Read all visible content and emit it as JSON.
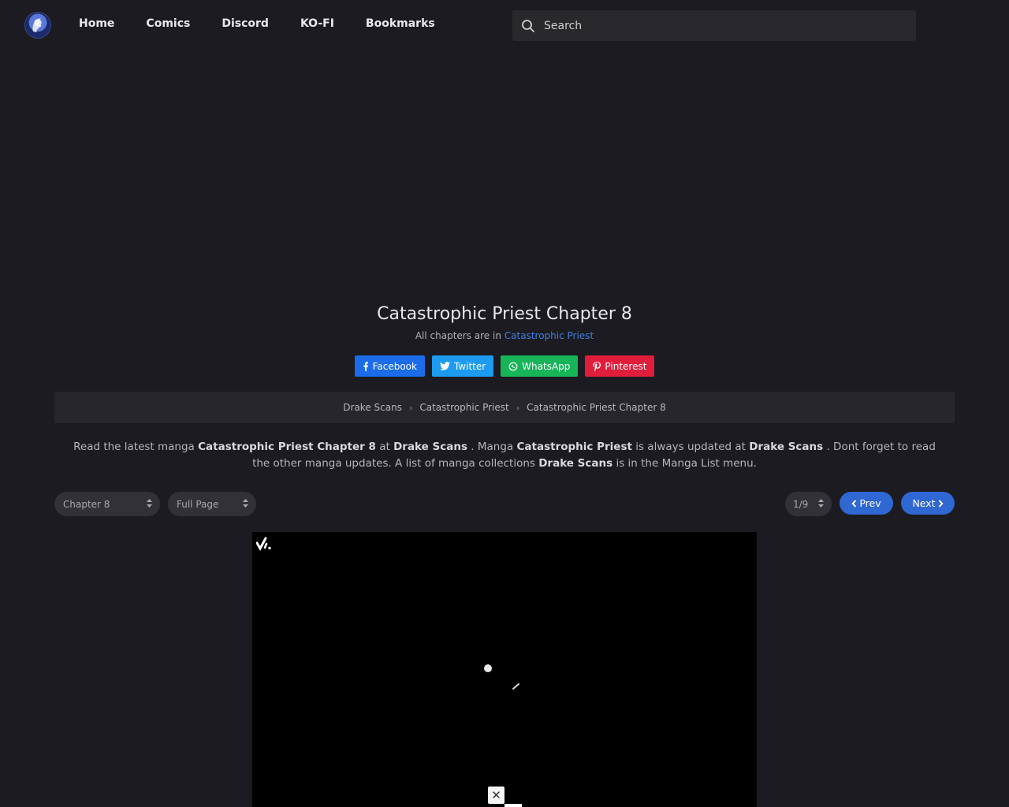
{
  "header": {
    "nav": [
      "Home",
      "Comics",
      "Discord",
      "KO-FI",
      "Bookmarks"
    ],
    "search_placeholder": "Search"
  },
  "chapter": {
    "title": "Catastrophic Priest Chapter 8",
    "all_chapters_prefix": "All chapters are in",
    "series_link": "Catastrophic Priest"
  },
  "share": {
    "facebook": "Facebook",
    "twitter": "Twitter",
    "whatsapp": "WhatsApp",
    "pinterest": "Pinterest"
  },
  "breadcrumb": [
    "Drake Scans",
    "Catastrophic Priest",
    "Catastrophic Priest Chapter 8"
  ],
  "description": {
    "t1": "Read the latest manga ",
    "b1": "Catastrophic Priest Chapter 8",
    "t2": " at ",
    "b2": "Drake Scans",
    "t3": " . Manga ",
    "b3": "Catastrophic Priest",
    "t4": " is always updated at ",
    "b4": "Drake Scans",
    "t5": " . Dont forget to read the other manga updates. A list of manga collections ",
    "b5": "Drake Scans",
    "t6": " is in the Manga List menu."
  },
  "controls": {
    "chapter_select": "Chapter 8",
    "mode_select": "Full Page",
    "page_select": "1/9",
    "prev": "Prev",
    "next": "Next"
  },
  "viewer": {
    "close_glyph": "✕"
  },
  "colors": {
    "background": "#1c1b21",
    "accent": "#2f67d3",
    "facebook": "#1a6ce8",
    "twitter": "#1d9bf0",
    "whatsapp": "#18b458",
    "pinterest": "#e01d3a"
  }
}
